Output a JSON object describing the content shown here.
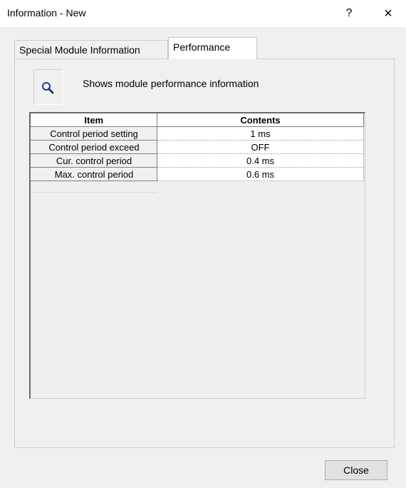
{
  "window": {
    "title": "Information - New",
    "help_label": "?",
    "close_label": "×"
  },
  "tabs": [
    {
      "label": "Special Module Information",
      "active": false
    },
    {
      "label": "Performance",
      "active": true
    }
  ],
  "description": {
    "icon": "search-icon",
    "text": "Shows module performance information"
  },
  "grid": {
    "columns": [
      "Item",
      "Contents"
    ],
    "rows": [
      {
        "item": "Control period setting",
        "contents": "1 ms"
      },
      {
        "item": "Control period exceed",
        "contents": "OFF"
      },
      {
        "item": "Cur. control period",
        "contents": "0.4 ms"
      },
      {
        "item": "Max. control period",
        "contents": "0.6 ms"
      }
    ]
  },
  "footer": {
    "close_button": "Close"
  },
  "colors": {
    "window_bg": "#f0f0f0",
    "title_bg": "#ffffff",
    "button_bg": "#e1e1e1"
  }
}
